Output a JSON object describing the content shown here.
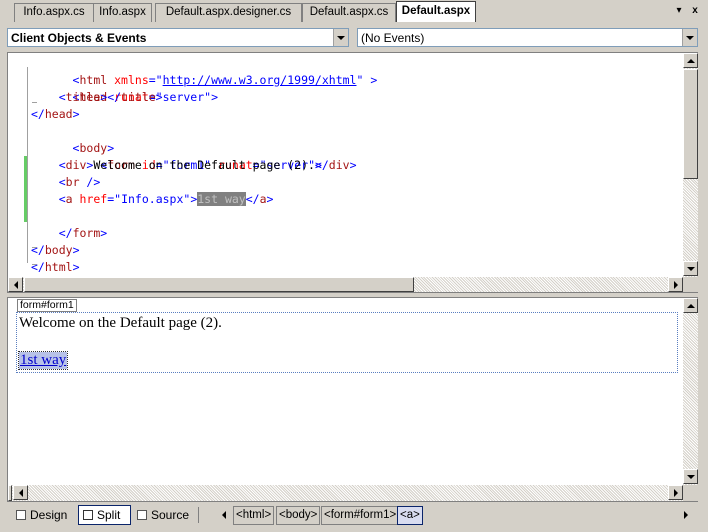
{
  "tabs": [
    {
      "label": "Info.aspx.cs",
      "active": false
    },
    {
      "label": "Info.aspx",
      "active": false
    },
    {
      "label": "Default.aspx.designer.cs",
      "active": false
    },
    {
      "label": "Default.aspx.cs",
      "active": false
    },
    {
      "label": "Default.aspx",
      "active": true
    }
  ],
  "tab_controls": {
    "dropdown": "▾",
    "close": "x"
  },
  "combos": {
    "objects": "Client Objects & Events",
    "events": "(No Events)"
  },
  "code": {
    "line1": {
      "open": "<",
      "tag": "html",
      "attr": "xmlns",
      "eq": "=\"",
      "url": "http://www.w3.org/1999/xhtml",
      "close": "\" >"
    },
    "line2": {
      "open": "<",
      "tag": "head",
      "attr": "runat",
      "eq": "=\"",
      "val": "server",
      "close": "\">"
    },
    "line3": {
      "open": "<",
      "tag": "title",
      "mid": "></",
      "tag2": "title",
      "close": ">"
    },
    "line4": {
      "open": "</",
      "tag": "head",
      "close": ">"
    },
    "line5": {
      "open": "<",
      "tag": "body",
      "close": ">"
    },
    "line6": {
      "open": "<",
      "tag": "form",
      "attr1": "id",
      "eq1": "=\"",
      "val1": "form1",
      "q1": "\"",
      "attr2": "runat",
      "eq2": "=\"",
      "val2": "server",
      "close": "\">"
    },
    "line7": {
      "open": "<",
      "tag": "div",
      "gt": ">",
      "text": "Welcome on the Default page (2).",
      "open2": "</",
      "tag2": "div",
      "close": ">"
    },
    "line8": {
      "open": "<",
      "tag": "br",
      "close": " />"
    },
    "line9": {
      "open": "<",
      "tag": "a",
      "attr": "href",
      "eq": "=\"",
      "val": "Info.aspx",
      "gt": "\">",
      "sel": "1st way",
      "open2": "</",
      "tag2": "a",
      "close": ">"
    },
    "line11": {
      "open": "</",
      "tag": "form",
      "close": ">"
    },
    "line12": {
      "open": "</",
      "tag": "body",
      "close": ">"
    },
    "line13": {
      "open": "</",
      "tag": "html",
      "close": ">"
    }
  },
  "fold_symbols": {
    "minus": "−"
  },
  "design": {
    "form_tag": "form#form1",
    "welcome_text": "Welcome on the Default page (2).",
    "link_text": "1st way"
  },
  "views": [
    {
      "label": "Design",
      "active": false
    },
    {
      "label": "Split",
      "active": true
    },
    {
      "label": "Source",
      "active": false
    }
  ],
  "breadcrumbs": [
    {
      "label": "<html>",
      "active": false
    },
    {
      "label": "<body>",
      "active": false
    },
    {
      "label": "<form#form1>",
      "active": false
    },
    {
      "label": "<a>",
      "active": true
    }
  ],
  "colors": {
    "tag": "#a31515",
    "bracket": "#0000ff",
    "attribute": "#ff0000",
    "value": "#0000ff",
    "change_bar": "#66cc66",
    "selection": "#808080"
  }
}
